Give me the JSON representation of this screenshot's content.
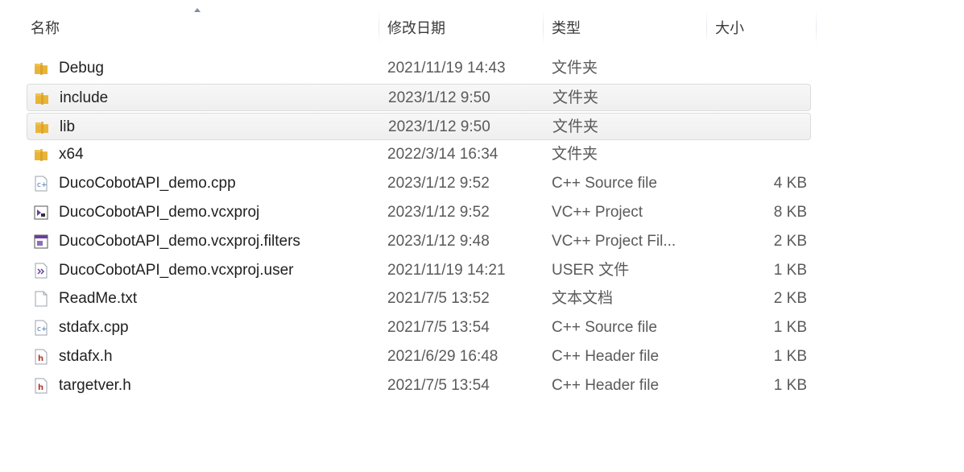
{
  "header": {
    "name": "名称",
    "date": "修改日期",
    "type": "类型",
    "size": "大小"
  },
  "files": [
    {
      "name": "Debug",
      "date": "2021/11/19 14:43",
      "type": "文件夹",
      "size": "",
      "icon": "folder-icon",
      "highlight": false
    },
    {
      "name": "include",
      "date": "2023/1/12 9:50",
      "type": "文件夹",
      "size": "",
      "icon": "folder-icon",
      "highlight": true
    },
    {
      "name": "lib",
      "date": "2023/1/12 9:50",
      "type": "文件夹",
      "size": "",
      "icon": "folder-icon",
      "highlight": true
    },
    {
      "name": "x64",
      "date": "2022/3/14 16:34",
      "type": "文件夹",
      "size": "",
      "icon": "folder-icon",
      "highlight": false
    },
    {
      "name": "DucoCobotAPI_demo.cpp",
      "date": "2023/1/12 9:52",
      "type": "C++ Source file",
      "size": "4 KB",
      "icon": "cpp-file-icon",
      "highlight": false
    },
    {
      "name": "DucoCobotAPI_demo.vcxproj",
      "date": "2023/1/12 9:52",
      "type": "VC++ Project",
      "size": "8 KB",
      "icon": "vcxproj-file-icon",
      "highlight": false
    },
    {
      "name": "DucoCobotAPI_demo.vcxproj.filters",
      "date": "2023/1/12 9:48",
      "type": "VC++ Project Fil...",
      "size": "2 KB",
      "icon": "filters-file-icon",
      "highlight": false
    },
    {
      "name": "DucoCobotAPI_demo.vcxproj.user",
      "date": "2021/11/19 14:21",
      "type": "USER 文件",
      "size": "1 KB",
      "icon": "user-file-icon",
      "highlight": false
    },
    {
      "name": "ReadMe.txt",
      "date": "2021/7/5 13:52",
      "type": "文本文档",
      "size": "2 KB",
      "icon": "text-file-icon",
      "highlight": false
    },
    {
      "name": "stdafx.cpp",
      "date": "2021/7/5 13:54",
      "type": "C++ Source file",
      "size": "1 KB",
      "icon": "cpp-file-icon",
      "highlight": false
    },
    {
      "name": "stdafx.h",
      "date": "2021/6/29 16:48",
      "type": "C++ Header file",
      "size": "1 KB",
      "icon": "header-file-icon",
      "highlight": false
    },
    {
      "name": "targetver.h",
      "date": "2021/7/5 13:54",
      "type": "C++ Header file",
      "size": "1 KB",
      "icon": "header-file-icon",
      "highlight": false
    }
  ],
  "colors": {
    "folder": "#e8b53a",
    "highlight_bg": "#f2f2f2",
    "cpp": "#4a6fb5",
    "header": "#b03a2e",
    "vcxproj": "#6b3fa0"
  }
}
